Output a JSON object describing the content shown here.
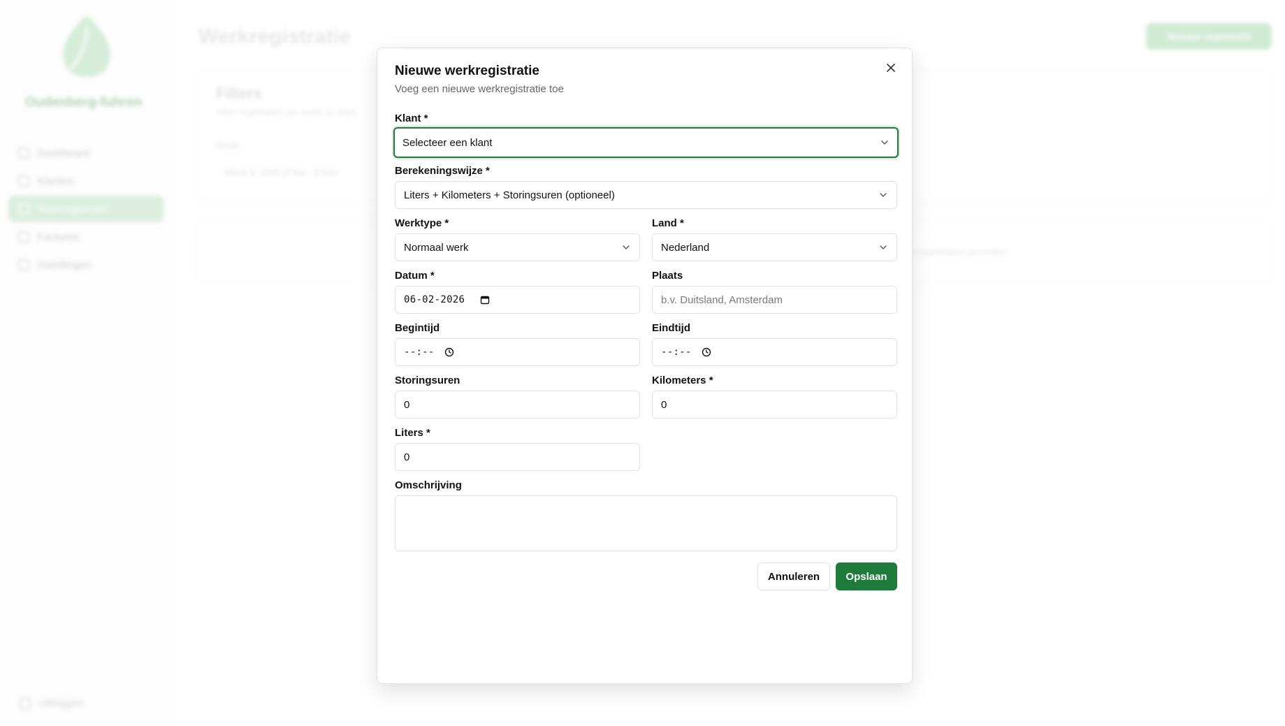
{
  "background": {
    "brand": "Oudenberg-fuhren",
    "nav": [
      {
        "label": "Dashboard",
        "icon": "grid-icon"
      },
      {
        "label": "Klanten",
        "icon": "users-icon"
      },
      {
        "label": "Werkregistratie",
        "icon": "clipboard-icon",
        "active": true
      },
      {
        "label": "Facturen",
        "icon": "file-icon"
      },
      {
        "label": "Instellingen",
        "icon": "gear-icon"
      }
    ],
    "logout": "Uitloggen",
    "page_title": "Werkregistratie",
    "new_button": "Nieuwe registratie",
    "filters_title": "Filters",
    "filters_subtitle": "Filter registraties per week en klant",
    "week_label": "Week",
    "week_value": "Week 6, 2026 (2 feb - 8 feb)",
    "empty_text": "Geen registraties gevonden"
  },
  "modal": {
    "title": "Nieuwe werkregistratie",
    "description": "Voeg een nieuwe werkregistratie toe",
    "fields": {
      "klant": {
        "label": "Klant *",
        "placeholder": "Selecteer een klant"
      },
      "berekeningswijze": {
        "label": "Berekeningswijze *",
        "value": "Liters + Kilometers + Storingsuren (optioneel)"
      },
      "werktype": {
        "label": "Werktype *",
        "value": "Normaal werk"
      },
      "land": {
        "label": "Land *",
        "value": "Nederland"
      },
      "datum": {
        "label": "Datum *",
        "value": "06-02-2026"
      },
      "plaats": {
        "label": "Plaats",
        "placeholder": "b.v. Duitsland, Amsterdam"
      },
      "begintijd": {
        "label": "Begintijd",
        "value": "--:--"
      },
      "eindtijd": {
        "label": "Eindtijd",
        "value": "--:--"
      },
      "storingsuren": {
        "label": "Storingsuren",
        "value": "0"
      },
      "kilometers": {
        "label": "Kilometers *",
        "value": "0"
      },
      "liters": {
        "label": "Liters *",
        "value": "0"
      },
      "omschrijving": {
        "label": "Omschrijving",
        "value": ""
      }
    },
    "buttons": {
      "cancel": "Annuleren",
      "save": "Opslaan"
    }
  },
  "colors": {
    "accent": "#1e7b3a",
    "border": "#e2e2e2"
  }
}
